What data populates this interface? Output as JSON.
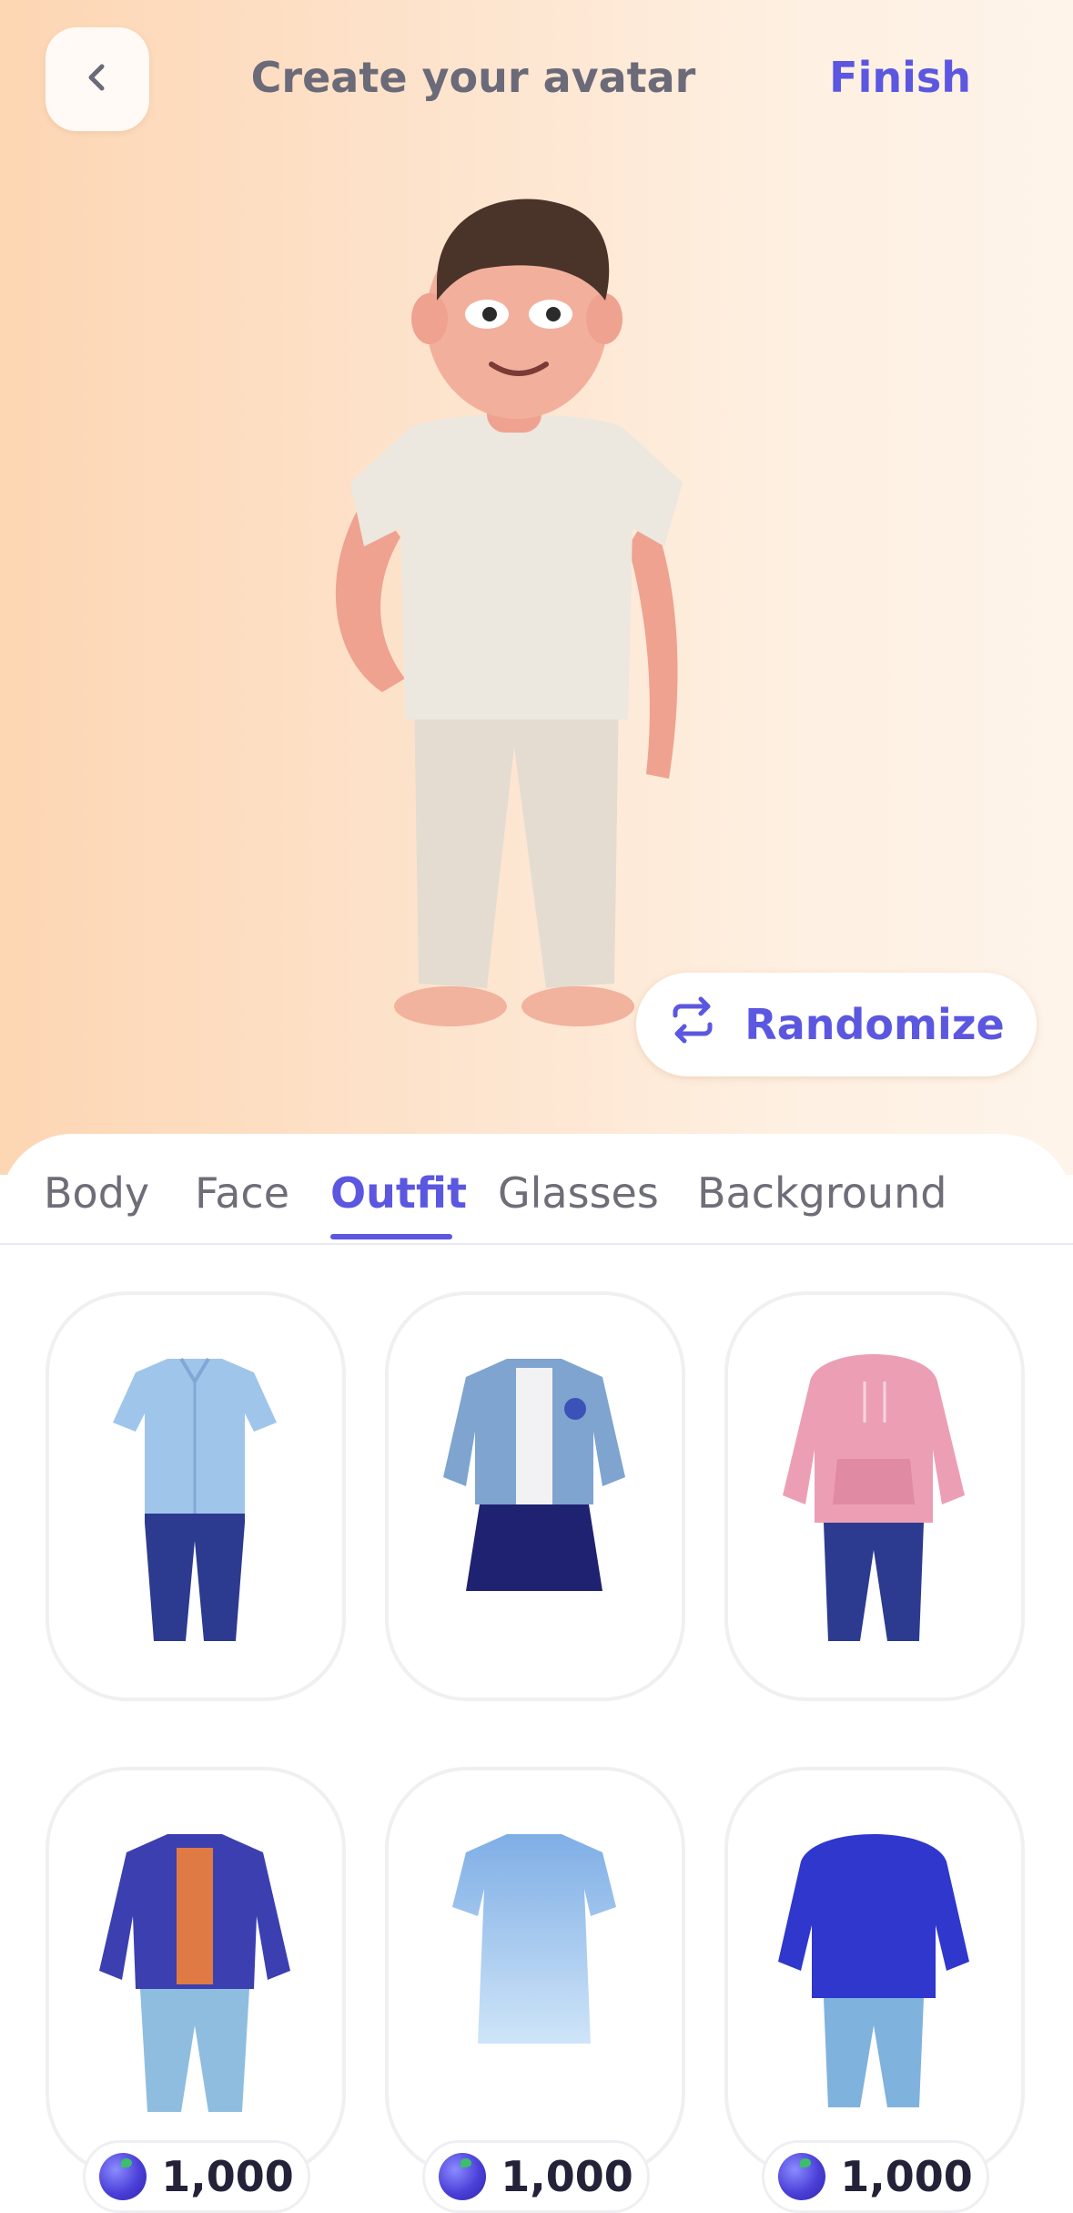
{
  "header": {
    "title": "Create your avatar",
    "finish_label": "Finish",
    "back_icon": "chevron-left-icon"
  },
  "preview": {
    "randomize_label": "Randomize",
    "randomize_icon": "shuffle-icon"
  },
  "tabs": [
    {
      "label": "Body",
      "active": false
    },
    {
      "label": "Face",
      "active": false
    },
    {
      "label": "Outfit",
      "active": true
    },
    {
      "label": "Glasses",
      "active": false
    },
    {
      "label": "Background",
      "active": false
    }
  ],
  "outfits": [
    {
      "name": "light-blue-shirt-jeans"
    },
    {
      "name": "denim-jacket-skirt"
    },
    {
      "name": "pink-hoodie-jeans"
    },
    {
      "name": "navy-jacket-orange-top-light-jeans",
      "price": "1,000"
    },
    {
      "name": "light-blue-dress",
      "price": "1,000"
    },
    {
      "name": "blue-fluffy-sweater-jeans",
      "price": "1,000"
    }
  ],
  "colors": {
    "accent": "#5b57e0",
    "hero_gradient_left": "#fdd6b3",
    "hero_gradient_right": "#fef4ea"
  }
}
